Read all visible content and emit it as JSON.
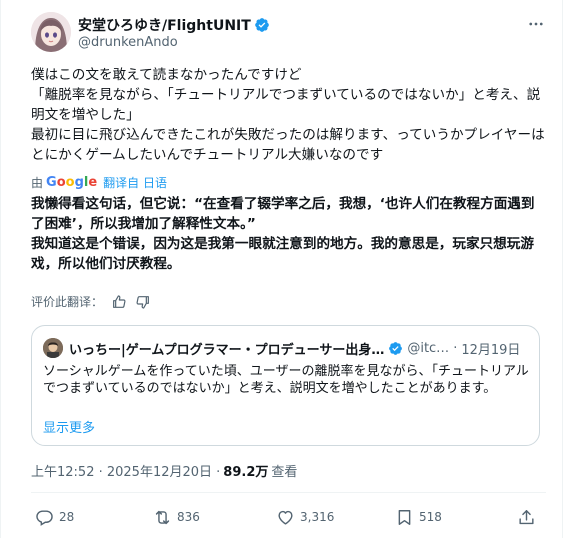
{
  "author": {
    "display_name": "安堂ひろゆき/FlightUNIT",
    "handle": "@drunkenAndo"
  },
  "tweet": {
    "text": "僕はこの文を敢えて読まなかったんですけど\n「離脱率を見ながら、「チュートリアルでつまずいているのではないか」と考え、説明文を増やした」\n最初に目に飛び込んできたこれが失敗だったのは解ります、っていうかプレイヤーはとにかくゲームしたいんでチュートリアル大嫌いなのです"
  },
  "translation": {
    "by_label": "由",
    "provider": [
      "G",
      "o",
      "o",
      "g",
      "l",
      "e"
    ],
    "translated_from": "翻译自 日语",
    "text": "我懒得看这句话，但它说：“在查看了辍学率之后，我想，‘也许人们在教程方面遇到了困难’，所以我增加了解释性文本。”\n我知道这是个错误，因为这是我第一眼就注意到的地方。我的意思是，玩家只想玩游戏，所以他们讨厌教程。",
    "rate_label": "评价此翻译："
  },
  "quote": {
    "display_name": "いっちー|ゲームプログラマー・プロデューサー出身…",
    "handle": "@itc…",
    "separator": "·",
    "date": "12月19日",
    "text": "ソーシャルゲームを作っていた頃、ユーザーの離脱率を見ながら、「チュートリアルでつまずいているのではないか」と考え、説明文を増やしたことがあります。",
    "show_more": "显示更多"
  },
  "meta": {
    "timestamp": "上午12:52 · 2025年12月20日 · ",
    "views": "89.2万",
    "views_label": "查看"
  },
  "actions": {
    "replies": "28",
    "reposts": "836",
    "likes": "3,316",
    "bookmarks": "518"
  },
  "colors": {
    "accent": "#1d9bf0",
    "text": "#0f1419",
    "secondary": "#536471"
  }
}
